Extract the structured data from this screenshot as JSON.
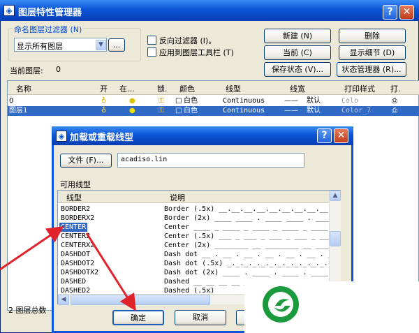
{
  "window": {
    "title": "图层特性管理器",
    "help_glyph": "?",
    "close_glyph": "✕"
  },
  "filter": {
    "legend": "命名图层过滤器 (N)",
    "selected": "显示所有图层",
    "more_button": "...",
    "invert_label": "反向过滤器 (I)。",
    "apply_toolbar_label": "应用到图层工具栏 (T)"
  },
  "buttons": {
    "new": "新建 (N)",
    "delete": "删除",
    "current": "当前 (C)",
    "show_details": "显示细节 (D)",
    "save_state": "保存状态 (V)...",
    "state_manager": "状态管理器 (R)..."
  },
  "current_layer": {
    "label": "当前图层:",
    "value": "0"
  },
  "layer_table": {
    "columns": [
      "名称",
      "开",
      "在...",
      "锁.",
      "颜色",
      "线型",
      "线宽",
      "打印样式",
      "打."
    ],
    "rows": [
      {
        "name": "0",
        "color": "白色",
        "linetype": "Continuous",
        "lineweight": "默认",
        "plot_style": "Colo",
        "selected": false
      },
      {
        "name": "图层1",
        "color": "白色",
        "linetype": "Continuous",
        "lineweight": "默认",
        "plot_style": "Color_7",
        "selected": true
      }
    ]
  },
  "status": {
    "total_layers": "2 图层总数"
  },
  "dialog": {
    "title": "加载或重载线型",
    "file_button": "文件 (F)...",
    "file_value": "acadiso.lin",
    "available_label": "可用线型",
    "col_linetype": "线型",
    "col_description": "说明",
    "linetypes": [
      {
        "name": "BORDER2",
        "desc": "Border (.5x) __.__.__.__.__.__.__.__.__."
      },
      {
        "name": "BORDERX2",
        "desc": "Border (2x) ____ ____ . ____ ____ . ____"
      },
      {
        "name": "CENTER",
        "desc": "Center ____ _ ____ _ ____ _ ____ _ ____",
        "selected": true
      },
      {
        "name": "CENTER2",
        "desc": "Center (.5x) ___ _ ___ _ ___ _ ___ _ ___"
      },
      {
        "name": "CENTERX2",
        "desc": "Center (2x) ________ __ ________ __ ____"
      },
      {
        "name": "DASHDOT",
        "desc": "Dash dot __ . __ . __ . __ . __ . __ . _"
      },
      {
        "name": "DASHDOT2",
        "desc": "Dash dot (.5x) _._._._._._._._._._._._."
      },
      {
        "name": "DASHDOTX2",
        "desc": "Dash dot (2x) ____ . ____ . ____ . ____"
      },
      {
        "name": "DASHED",
        "desc": "Dashed __ __ __ __ __ __ __ __ __ __ __"
      },
      {
        "name": "DASHED2",
        "desc": "Dashed (.5x) _ _ _ _ _ _ _ _ _ _ _ _ _ _"
      }
    ],
    "ok_button": "确定",
    "cancel_button": "取消"
  },
  "colors": {
    "titlebar": "#0b55d6",
    "selection": "#316ac5",
    "annotation_arrow": "#e0232b",
    "logo_green": "#1a9a3c"
  }
}
